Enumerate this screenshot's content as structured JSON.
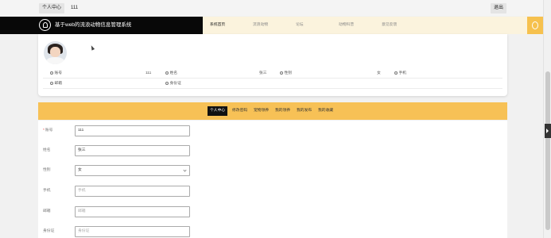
{
  "topbar": {
    "user_center": "个人中心",
    "username": "111",
    "logout": "退出"
  },
  "header": {
    "title": "基于web的流浪动物信息管理系统"
  },
  "menu": [
    {
      "label": "系统首页",
      "active": true
    },
    {
      "label": "流浪动物",
      "active": false
    },
    {
      "label": "论坛",
      "active": false
    },
    {
      "label": "动物科普",
      "active": false
    },
    {
      "label": "意见反馈",
      "active": false
    }
  ],
  "profile": {
    "row1": [
      {
        "label": "账号",
        "value": "111"
      },
      {
        "label": "姓名",
        "value": "张三"
      },
      {
        "label": "性别",
        "value": "女"
      },
      {
        "label": "手机",
        "value": ""
      }
    ],
    "row2": [
      {
        "label": "邮箱",
        "value": ""
      },
      {
        "label": "身份证",
        "value": ""
      }
    ]
  },
  "tabs": [
    {
      "label": "个人中心",
      "active": true
    },
    {
      "label": "修改密码",
      "active": false
    },
    {
      "label": "宠物领养",
      "active": false
    },
    {
      "label": "我的领养",
      "active": false
    },
    {
      "label": "我的发布",
      "active": false
    },
    {
      "label": "我的收藏",
      "active": false
    }
  ],
  "form": {
    "account": {
      "label": "账号",
      "required": "*",
      "value": "111"
    },
    "name": {
      "label": "姓名",
      "value": "张三"
    },
    "gender": {
      "label": "性别",
      "value": "女"
    },
    "phone": {
      "label": "手机",
      "placeholder": "手机"
    },
    "email": {
      "label": "邮箱",
      "placeholder": "邮箱"
    },
    "idcard": {
      "label": "身份证",
      "placeholder": "身份证"
    }
  },
  "colors": {
    "accent": "#f7c156",
    "brand_bg": "#080808",
    "menu_bg": "#fbf3dd"
  },
  "icons": {
    "logo": "lightbulb-icon",
    "avatar": "user-avatar-icon"
  }
}
